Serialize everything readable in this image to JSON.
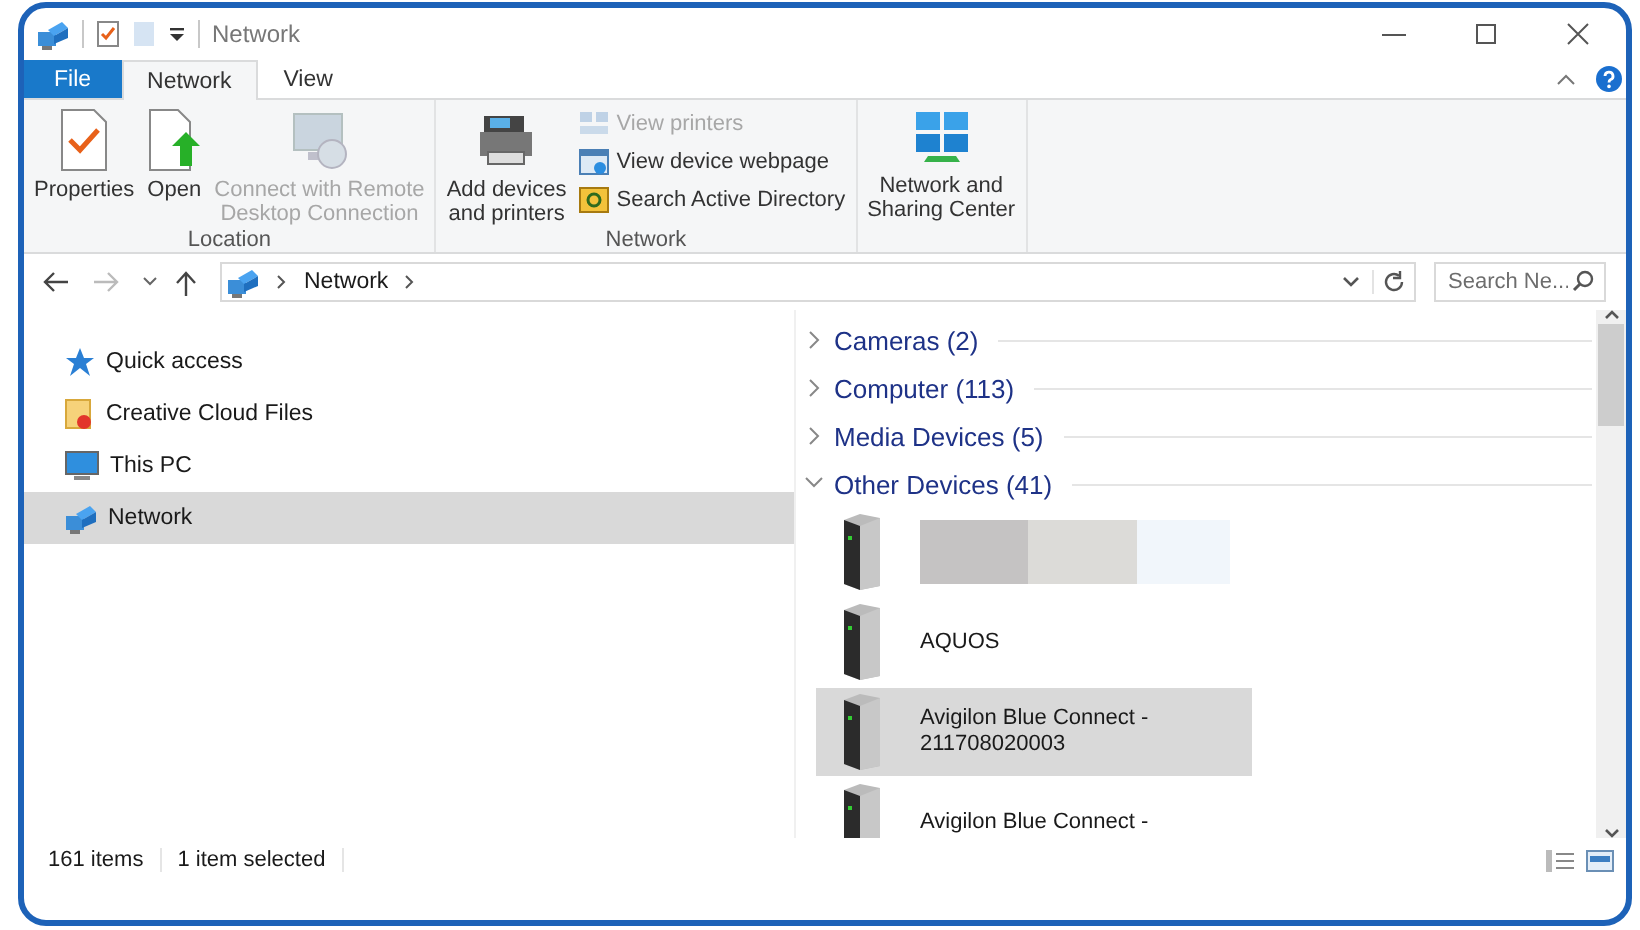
{
  "window": {
    "title": "Network"
  },
  "ribbon_tabs": [
    {
      "label": "File",
      "kind": "file",
      "selected": false
    },
    {
      "label": "Network",
      "kind": "tab",
      "selected": true
    },
    {
      "label": "View",
      "kind": "tab",
      "selected": false
    }
  ],
  "ribbon_groups": [
    {
      "label": "Location",
      "commands": [
        {
          "label": "Properties",
          "kind": "large",
          "disabled": false
        },
        {
          "label": "Open",
          "kind": "large",
          "disabled": false
        },
        {
          "label": "Connect with Remote\nDesktop Connection",
          "kind": "large",
          "disabled": true
        }
      ]
    },
    {
      "label": "Network",
      "commands": [
        {
          "label": "Add devices\nand printers",
          "kind": "large",
          "disabled": false
        },
        {
          "label": "View printers",
          "kind": "small",
          "disabled": true
        },
        {
          "label": "View device webpage",
          "kind": "small",
          "disabled": false
        },
        {
          "label": "Search Active Directory",
          "kind": "small",
          "disabled": false
        }
      ]
    },
    {
      "commands": [
        {
          "label": "Network and\nSharing Center",
          "kind": "large",
          "disabled": false
        }
      ]
    }
  ],
  "address": {
    "path": [
      "Network"
    ]
  },
  "search": {
    "placeholder": "Search Ne..."
  },
  "nav_items": [
    {
      "label": "Quick access",
      "selected": false
    },
    {
      "label": "Creative Cloud Files",
      "selected": false
    },
    {
      "label": "This PC",
      "selected": false
    },
    {
      "label": "Network",
      "selected": true
    }
  ],
  "groups": [
    {
      "label": "Cameras (2)",
      "expanded": false
    },
    {
      "label": "Computer (113)",
      "expanded": false
    },
    {
      "label": "Media Devices (5)",
      "expanded": false
    },
    {
      "label": "Other Devices (41)",
      "expanded": true,
      "items": [
        {
          "kind": "redacted",
          "selected": false
        },
        {
          "kind": "device",
          "lines": [
            "AQUOS"
          ],
          "selected": false
        },
        {
          "kind": "device",
          "lines": [
            "Avigilon Blue Connect -",
            "211708020003"
          ],
          "selected": true
        },
        {
          "kind": "device",
          "lines": [
            "Avigilon Blue Connect -"
          ],
          "selected": false
        }
      ]
    }
  ],
  "status_bar": {
    "item_count": "161 items",
    "selection": "1 item selected"
  }
}
